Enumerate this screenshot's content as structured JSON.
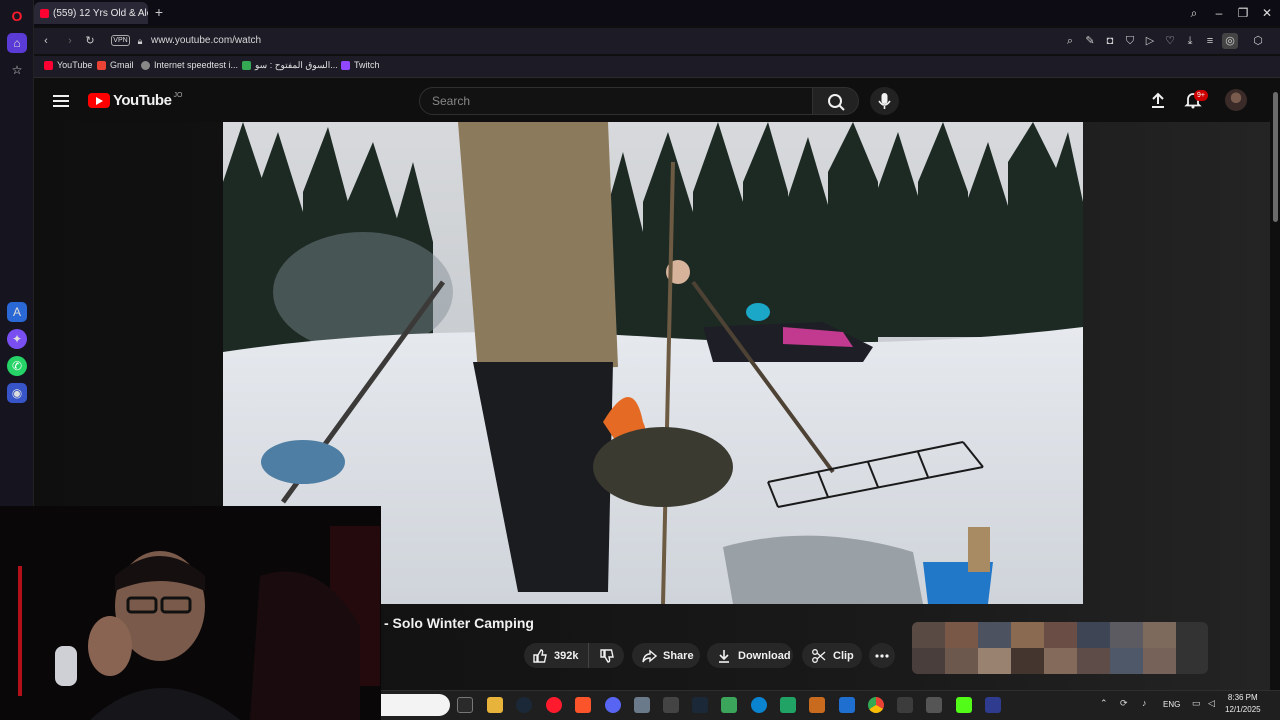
{
  "browser": {
    "tab_title": "(559) 12 Yrs Old & Alo",
    "url": "www.youtube.com/watch",
    "vpn_label": "VPN",
    "bookmarks": [
      {
        "label": "YouTube",
        "color": "#ff0033"
      },
      {
        "label": "Gmail",
        "color": "#ea4335"
      },
      {
        "label": "Internet speedtest i...",
        "color": "#888888"
      },
      {
        "label": "السوق المفتوح : سو...",
        "color": "#35a853"
      },
      {
        "label": "Twitch",
        "color": "#9146ff"
      }
    ]
  },
  "youtube": {
    "logo_text": "YouTube",
    "country_code": "JO",
    "search_placeholder": "Search",
    "notification_count": "9+",
    "video_title_visible": "- Solo Winter Camping",
    "actions": {
      "likes": "392k",
      "share": "Share",
      "download": "Download",
      "clip": "Clip"
    }
  },
  "taskbar": {
    "language": "ENG",
    "time": "8:36 PM",
    "date": "12/1/2025"
  },
  "colors": {
    "accent_red": "#ff0000",
    "page_bg": "#0f0f0f",
    "pill_bg": "#272727"
  }
}
